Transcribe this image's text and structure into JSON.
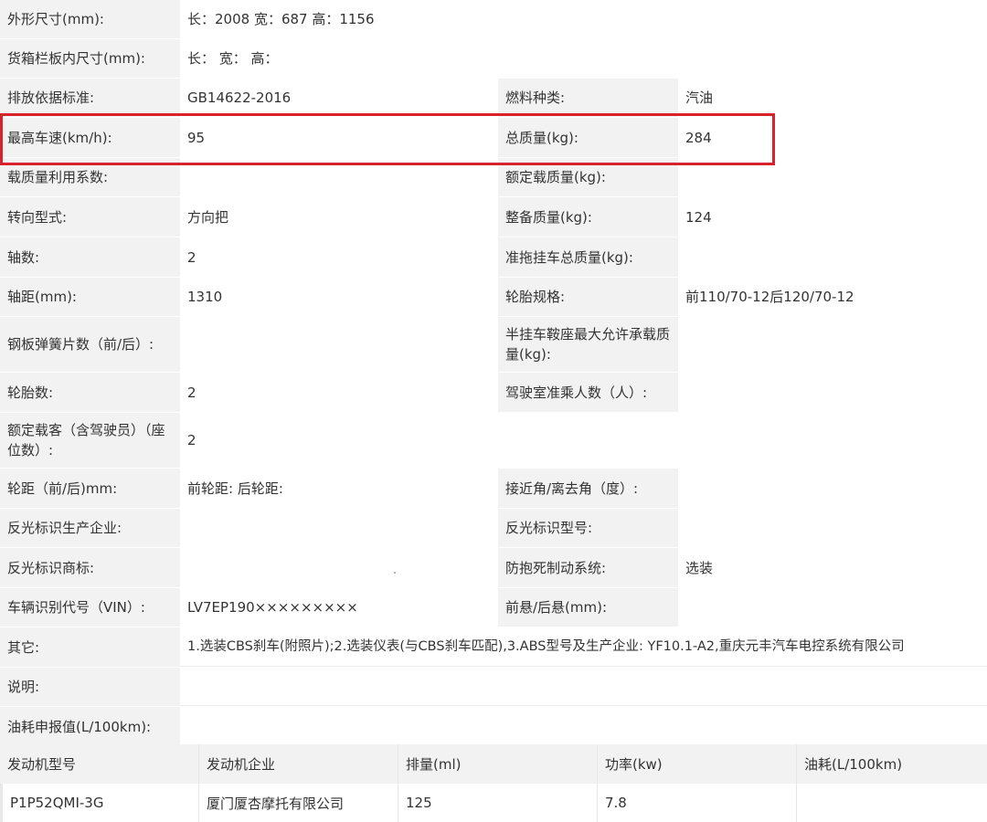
{
  "rows": [
    {
      "l1": "外形尺寸(mm):",
      "v1": "长：2008 宽：687 高：1156"
    },
    {
      "l1": "货箱栏板内尺寸(mm):",
      "v1": "长：  宽：  高："
    },
    {
      "l1": "排放依据标准:",
      "v1": "GB14622-2016",
      "l2": "燃料种类:",
      "v2": "汽油"
    },
    {
      "l1": "最高车速(km/h):",
      "v1": "95",
      "l2": "总质量(kg):",
      "v2": "284"
    },
    {
      "l1": "载质量利用系数:",
      "v1": "",
      "l2": "额定载质量(kg):",
      "v2": ""
    },
    {
      "l1": "转向型式:",
      "v1": "方向把",
      "l2": "整备质量(kg):",
      "v2": "124"
    },
    {
      "l1": "轴数:",
      "v1": "2",
      "l2": "准拖挂车总质量(kg):",
      "v2": ""
    },
    {
      "l1": "轴距(mm):",
      "v1": "1310",
      "l2": "轮胎规格:",
      "v2": "前110/70-12后120/70-12"
    },
    {
      "l1": "钢板弹簧片数（前/后）:",
      "v1": "",
      "l2": "半挂车鞍座最大允许承载质量(kg):",
      "v2": ""
    },
    {
      "l1": "轮胎数:",
      "v1": "2",
      "l2": "驾驶室准乘人数（人）:",
      "v2": ""
    },
    {
      "l1": "额定载客（含驾驶员）（座位数）:",
      "v1": "2"
    },
    {
      "l1": "轮距（前/后)mm:",
      "v1": "前轮距: 后轮距:",
      "l2": "接近角/离去角（度）:",
      "v2": ""
    },
    {
      "l1": "反光标识生产企业:",
      "v1": "",
      "l2": "反光标识型号:",
      "v2": ""
    },
    {
      "l1": "反光标识商标:",
      "v1": "",
      "l2": "防抱死制动系统:",
      "v2": "选装"
    },
    {
      "l1": "车辆识别代号（VIN）:",
      "v1": "LV7EP190×××××××××",
      "l2": "前悬/后悬(mm):",
      "v2": ""
    },
    {
      "l1": "其它:",
      "v1": "1.选装CBS刹车(附照片);2.选装仪表(与CBS刹车匹配),3.ABS型号及生产企业: YF10.1-A2,重庆元丰汽车电控系统有限公司"
    },
    {
      "l1": "说明:",
      "v1": ""
    },
    {
      "l1": "油耗申报值(L/100km):",
      "v1": ""
    }
  ],
  "engine": {
    "headers": [
      "发动机型号",
      "发动机企业",
      "排量(ml)",
      "功率(kw)",
      "油耗(L/100km)"
    ],
    "cells": [
      "P1P52QMI-3G",
      "厦门厦杏摩托有限公司",
      "125",
      "7.8",
      ""
    ]
  },
  "colors": {
    "highlight": "#d9232c",
    "label_bg": "#f2f2f2"
  }
}
